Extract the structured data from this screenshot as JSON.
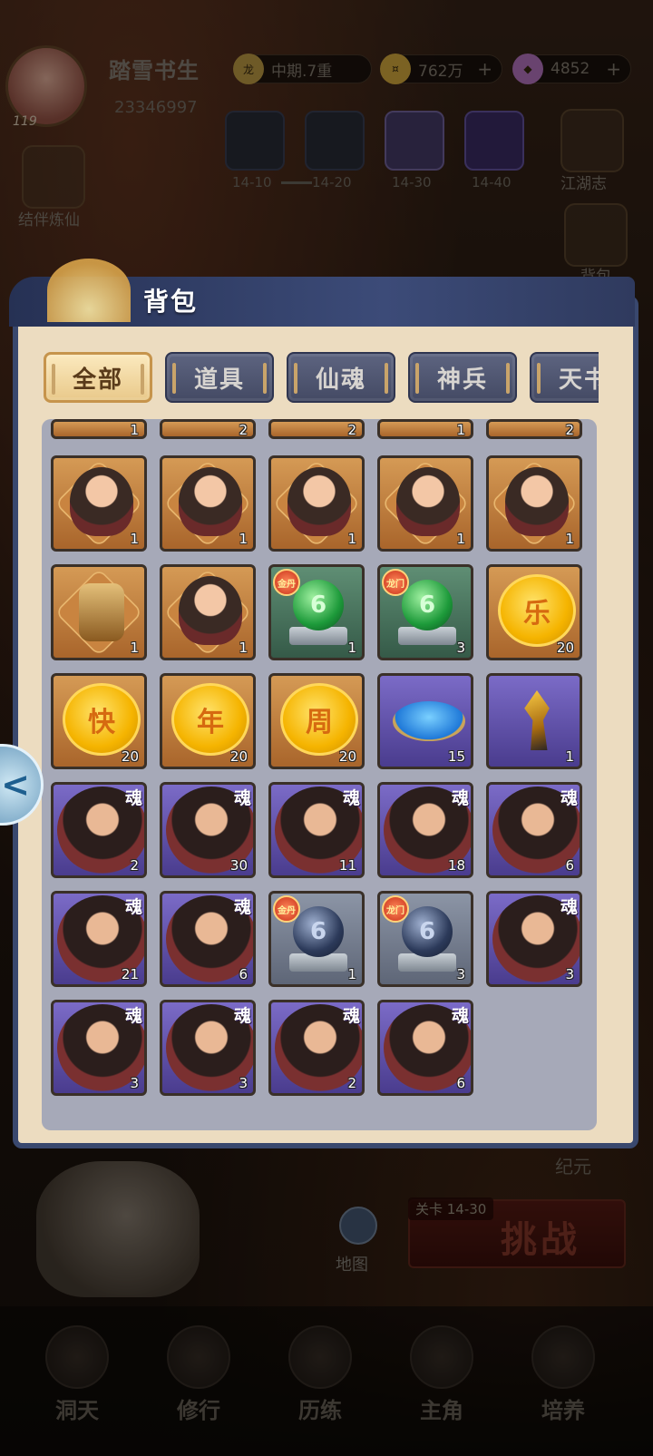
{
  "player": {
    "name": "踏雪书生",
    "id": "23346997",
    "level": "119",
    "realm": "中期.7重",
    "coins": "762万",
    "gems": "4852"
  },
  "stages": [
    {
      "label": "14-10"
    },
    {
      "label": "14-20"
    },
    {
      "label": "14-30"
    },
    {
      "label": "14-40"
    }
  ],
  "side": {
    "left_label": "结伴炼仙",
    "right_label_1": "江湖志",
    "right_label_2": "背包"
  },
  "modal": {
    "title": "背包",
    "tabs": [
      {
        "label": "全部",
        "active": true
      },
      {
        "label": "道具",
        "active": false
      },
      {
        "label": "仙魂",
        "active": false
      },
      {
        "label": "神兵",
        "active": false
      },
      {
        "label": "天书",
        "active": false
      }
    ]
  },
  "items_partial": [
    "1",
    "2",
    "2",
    "1",
    "2"
  ],
  "items": [
    {
      "type": "portrait-frame",
      "color": "orange",
      "count": "1",
      "icon": "hero-portrait"
    },
    {
      "type": "portrait-frame",
      "color": "orange",
      "count": "1",
      "icon": "monk-portrait"
    },
    {
      "type": "portrait-frame",
      "color": "orange",
      "count": "1",
      "icon": "elder-portrait"
    },
    {
      "type": "portrait-frame",
      "color": "orange",
      "count": "1",
      "icon": "warrior-portrait"
    },
    {
      "type": "portrait-frame",
      "color": "orange",
      "count": "1",
      "icon": "swordsman-portrait"
    },
    {
      "type": "idol",
      "color": "orange",
      "count": "1",
      "icon": "idol-icon"
    },
    {
      "type": "portrait-frame",
      "color": "orange",
      "count": "1",
      "icon": "mage-portrait"
    },
    {
      "type": "orb",
      "color": "green",
      "count": "1",
      "badge": "金丹",
      "orb_char": "6"
    },
    {
      "type": "orb",
      "color": "green",
      "count": "3",
      "badge": "龙门",
      "orb_char": "6"
    },
    {
      "type": "coin",
      "color": "orange",
      "count": "20",
      "coin_char": "乐"
    },
    {
      "type": "coin",
      "color": "orange",
      "count": "20",
      "coin_char": "快"
    },
    {
      "type": "coin",
      "color": "orange",
      "count": "20",
      "coin_char": "年"
    },
    {
      "type": "coin",
      "color": "orange",
      "count": "20",
      "coin_char": "周"
    },
    {
      "type": "sand",
      "color": "purple",
      "count": "15"
    },
    {
      "type": "weapon",
      "color": "purple",
      "count": "1"
    },
    {
      "type": "soul",
      "color": "purple",
      "count": "2",
      "tag": "魂"
    },
    {
      "type": "soul",
      "color": "purple",
      "count": "30",
      "tag": "魂"
    },
    {
      "type": "soul",
      "color": "purple",
      "count": "11",
      "tag": "魂"
    },
    {
      "type": "soul",
      "color": "purple",
      "count": "18",
      "tag": "魂"
    },
    {
      "type": "soul",
      "color": "purple",
      "count": "6",
      "tag": "魂"
    },
    {
      "type": "soul",
      "color": "purple",
      "count": "21",
      "tag": "魂"
    },
    {
      "type": "soul",
      "color": "purple",
      "count": "6",
      "tag": "魂"
    },
    {
      "type": "orb-dark",
      "color": "gray",
      "count": "1",
      "badge": "金丹",
      "orb_char": "6"
    },
    {
      "type": "orb-dark",
      "color": "gray",
      "count": "3",
      "badge": "龙门",
      "orb_char": "6"
    },
    {
      "type": "soul",
      "color": "purple",
      "count": "3",
      "tag": "魂"
    },
    {
      "type": "soul",
      "color": "purple",
      "count": "3",
      "tag": "魂"
    },
    {
      "type": "soul",
      "color": "purple",
      "count": "3",
      "tag": "魂"
    },
    {
      "type": "soul",
      "color": "purple",
      "count": "2",
      "tag": "魂"
    },
    {
      "type": "soul",
      "color": "purple",
      "count": "6",
      "tag": "魂"
    }
  ],
  "bottom": {
    "jiyuan": "纪元",
    "map": "地图",
    "stage_badge": "关卡 14-30",
    "challenge": "挑战",
    "nav": [
      "洞天",
      "修行",
      "历练",
      "主角",
      "培养"
    ]
  }
}
